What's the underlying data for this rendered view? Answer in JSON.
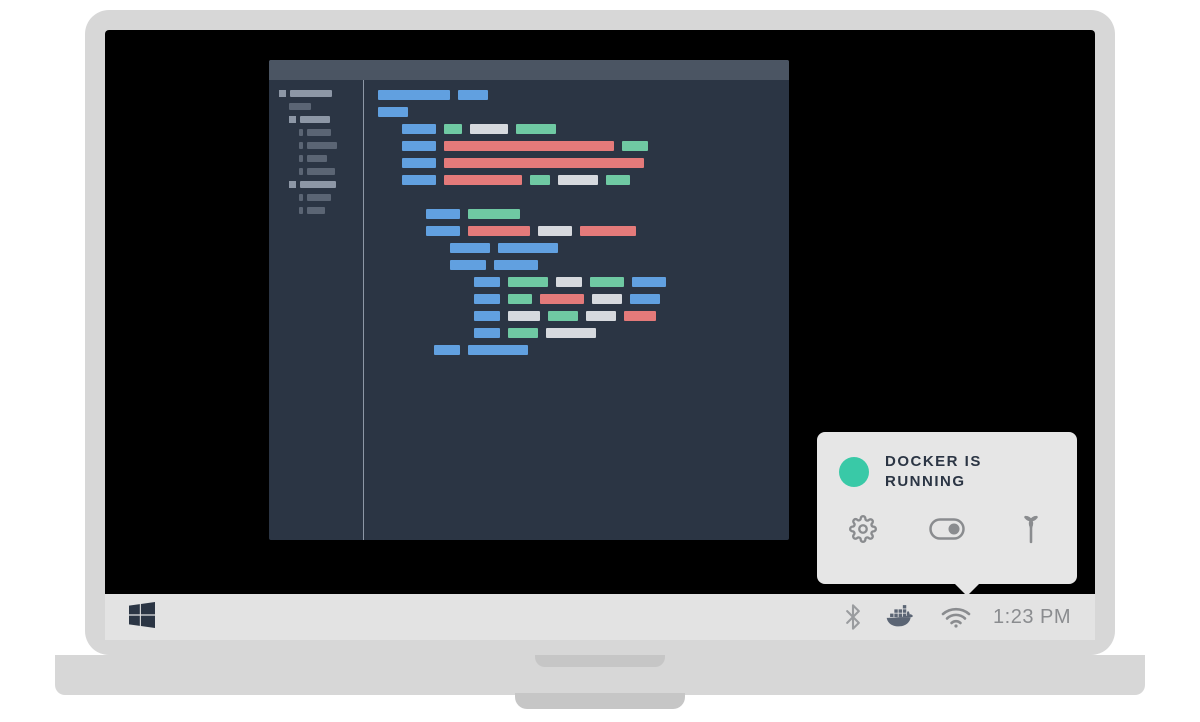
{
  "popover": {
    "status_text": "DOCKER IS RUNNING",
    "status_color": "#39c9a7",
    "actions": {
      "settings": "settings-icon",
      "toggle": "toggle-icon",
      "tools": "wrench-icon"
    }
  },
  "taskbar": {
    "clock": "1:23 PM",
    "tray_icons": [
      "bluetooth",
      "docker",
      "wifi"
    ]
  },
  "editor": {
    "colors": {
      "bg": "#2b3544",
      "titlebar": "#4b5563",
      "blue": "#61a0e0",
      "green": "#6fc9a3",
      "red": "#e47a7a",
      "grey": "#d6d9de"
    }
  }
}
